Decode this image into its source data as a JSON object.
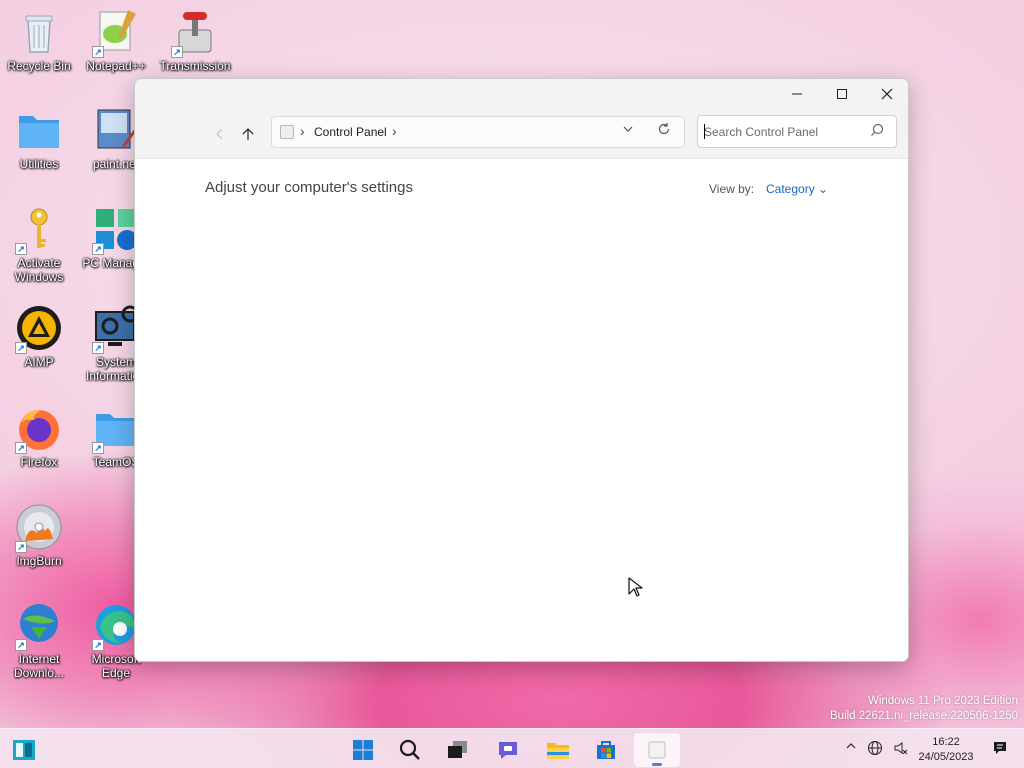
{
  "desktop": {
    "icons": [
      {
        "label": "Recycle Bin"
      },
      {
        "label": "Notepad++"
      },
      {
        "label": "Transmission"
      },
      {
        "label": "Utilities"
      },
      {
        "label": "paint.net"
      },
      {
        "label": "Activate Windows"
      },
      {
        "label": "PC Manager"
      },
      {
        "label": "AIMP"
      },
      {
        "label": "System Information"
      },
      {
        "label": "Firefox"
      },
      {
        "label": "TeamOS"
      },
      {
        "label": "ImgBurn"
      },
      {
        "label": "Internet Downlo..."
      },
      {
        "label": "Microsoft Edge"
      }
    ]
  },
  "window": {
    "address": {
      "crumb": "Control Panel",
      "separator": "›"
    },
    "search": {
      "placeholder": "Search Control Panel"
    },
    "heading": "Adjust your computer's settings",
    "view_by_label": "View by:",
    "view_by_value": "Category ⌄"
  },
  "watermark": {
    "line1": "Windows 11 Pro 2023 Edition",
    "line2": "Build 22621.ni_release.220506-1250"
  },
  "taskbar": {
    "time": "16:22",
    "date": "24/05/2023"
  },
  "colors": {
    "accent": "#1a64c8",
    "window_chrome": "#f3f3f3"
  }
}
